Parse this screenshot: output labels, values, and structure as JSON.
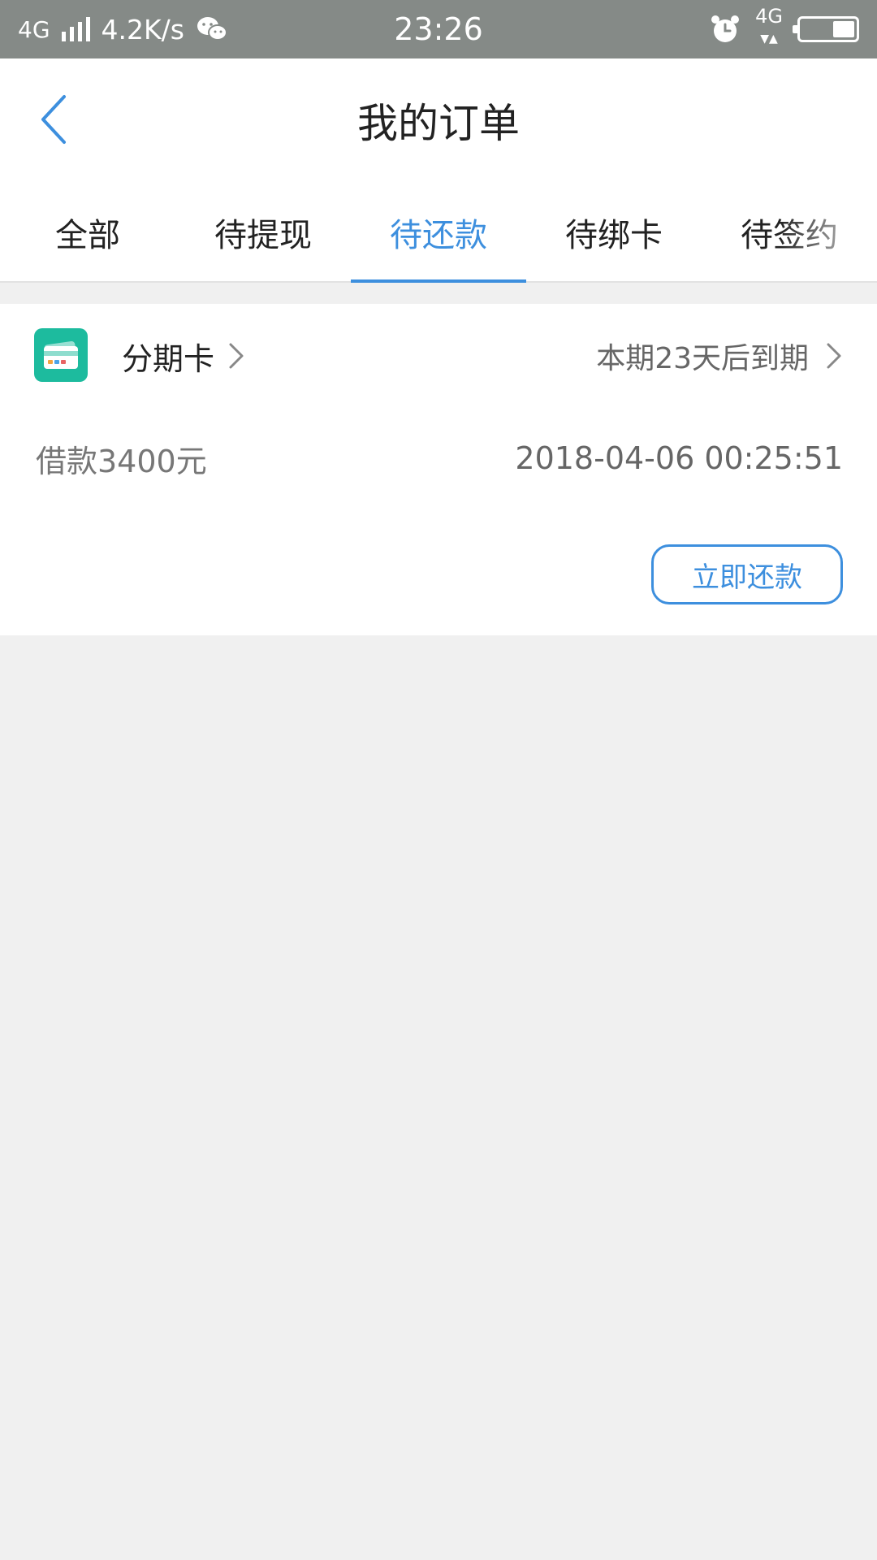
{
  "status_bar": {
    "network_left": "4G",
    "speed": "4.2K/s",
    "time": "23:26",
    "network_right": "4G",
    "battery_level": 0.4
  },
  "header": {
    "title": "我的订单"
  },
  "tabs": [
    {
      "label": "全部",
      "active": false
    },
    {
      "label": "待提现",
      "active": false
    },
    {
      "label": "待还款",
      "active": true
    },
    {
      "label": "待绑卡",
      "active": false
    },
    {
      "label": "待签约",
      "active": false
    }
  ],
  "order": {
    "product_name": "分期卡",
    "due_text": "本期23天后到期",
    "loan_amount": "借款3400元",
    "datetime": "2018-04-06 00:25:51",
    "repay_label": "立即还款"
  },
  "colors": {
    "accent": "#3d8fde",
    "status_bar": "#858a87",
    "product_icon": "#1dbb9e",
    "background": "#f0f0f0"
  },
  "icons": [
    "signal-icon",
    "wechat-icon",
    "alarm-icon",
    "battery-icon",
    "back-arrow-icon",
    "card-icon",
    "chevron-right-icon"
  ]
}
